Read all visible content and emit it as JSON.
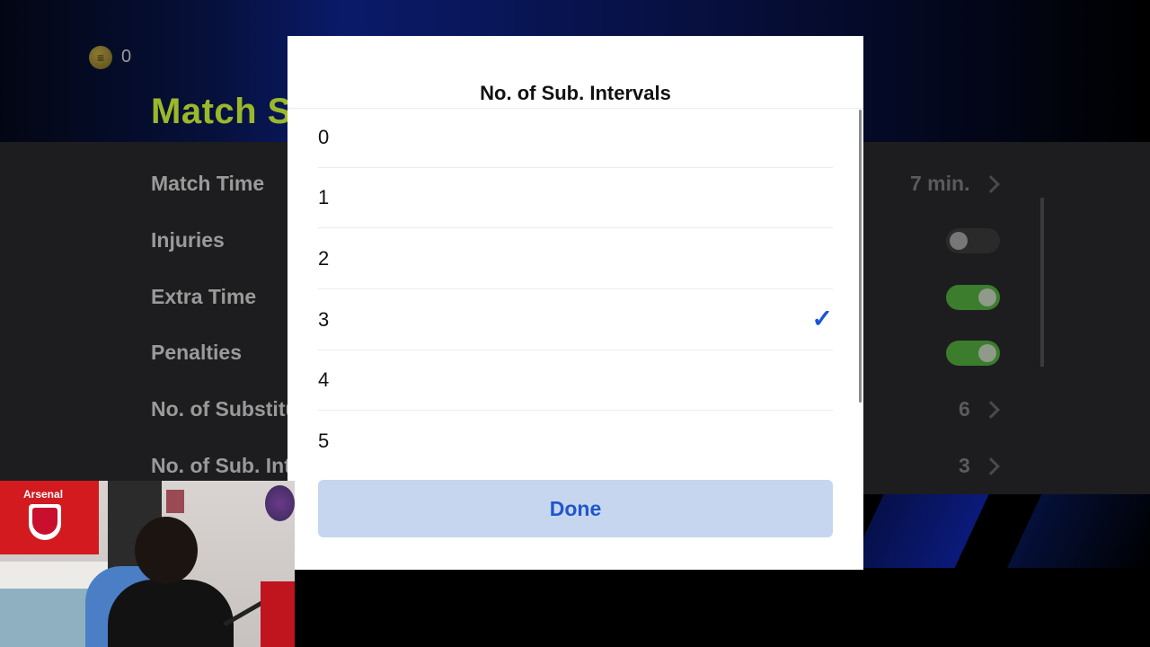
{
  "background": {
    "coins": "0",
    "heading": "Match Settings",
    "settings": [
      {
        "label": "Match Time",
        "value": "7 min."
      },
      {
        "label": "Injuries",
        "toggle": "off"
      },
      {
        "label": "Extra Time",
        "toggle": "on"
      },
      {
        "label": "Penalties",
        "toggle": "on"
      },
      {
        "label": "No. of Substitutions",
        "value": "6"
      },
      {
        "label": "No. of Sub. Intervals",
        "value": "3"
      }
    ]
  },
  "modal": {
    "title": "No. of Sub. Intervals",
    "options": [
      "0",
      "1",
      "2",
      "3",
      "4",
      "5"
    ],
    "selected": "3",
    "check_icon": "checkmark-icon",
    "done_label": "Done"
  },
  "webcam": {
    "flag_text": "Arsenal"
  },
  "colors": {
    "accent_blue": "#1a56d6",
    "done_button_bg": "#c7d6ef",
    "heading_green": "#9bb82a",
    "toggle_on": "#3b7d2c"
  }
}
